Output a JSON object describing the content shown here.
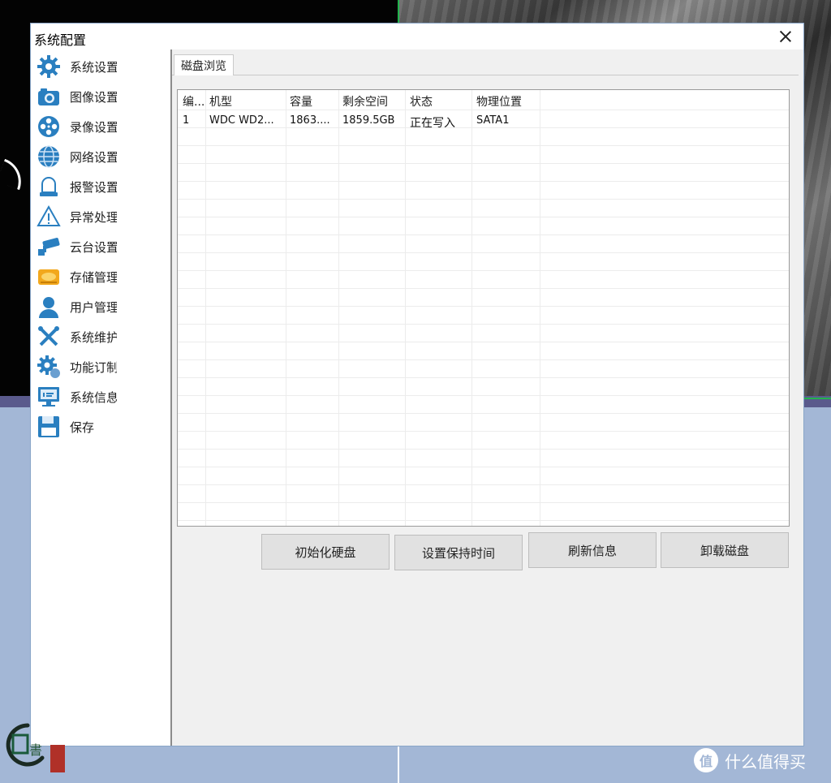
{
  "window": {
    "title": "系统配置"
  },
  "sidebar": {
    "items": [
      {
        "label": "系统设置",
        "icon": "gear-icon"
      },
      {
        "label": "图像设置",
        "icon": "camera-icon"
      },
      {
        "label": "录像设置",
        "icon": "film-reel-icon"
      },
      {
        "label": "网络设置",
        "icon": "globe-icon"
      },
      {
        "label": "报警设置",
        "icon": "alarm-bell-icon"
      },
      {
        "label": "异常处理",
        "icon": "warning-triangle-icon"
      },
      {
        "label": "云台设置",
        "icon": "ptz-camera-icon"
      },
      {
        "label": "存储管理",
        "icon": "hard-disk-icon"
      },
      {
        "label": "用户管理",
        "icon": "user-icon"
      },
      {
        "label": "系统维护",
        "icon": "tools-icon"
      },
      {
        "label": "功能订制",
        "icon": "gear-custom-icon"
      },
      {
        "label": "系统信息",
        "icon": "info-monitor-icon"
      },
      {
        "label": "保存",
        "icon": "floppy-disk-icon"
      }
    ]
  },
  "tabs": [
    {
      "label": "磁盘浏览"
    }
  ],
  "table": {
    "headers": [
      "编...",
      "机型",
      "容量",
      "剩余空间",
      "状态",
      "物理位置"
    ],
    "rows": [
      [
        "1",
        "WDC WD2...",
        "1863....",
        "1859.5GB",
        "正在写入",
        "SATA1"
      ]
    ]
  },
  "buttons": {
    "init": "初始化硬盘",
    "hold_time": "设置保持时间",
    "refresh": "刷新信息",
    "unmount": "卸载磁盘"
  },
  "watermark": {
    "right_text": "什么值得买",
    "right_glyph": "值"
  },
  "colors": {
    "dialog_bg": "#f0f0f0",
    "desktop_bg": "#a3b7d6",
    "button_bg": "#e1e1e1"
  }
}
